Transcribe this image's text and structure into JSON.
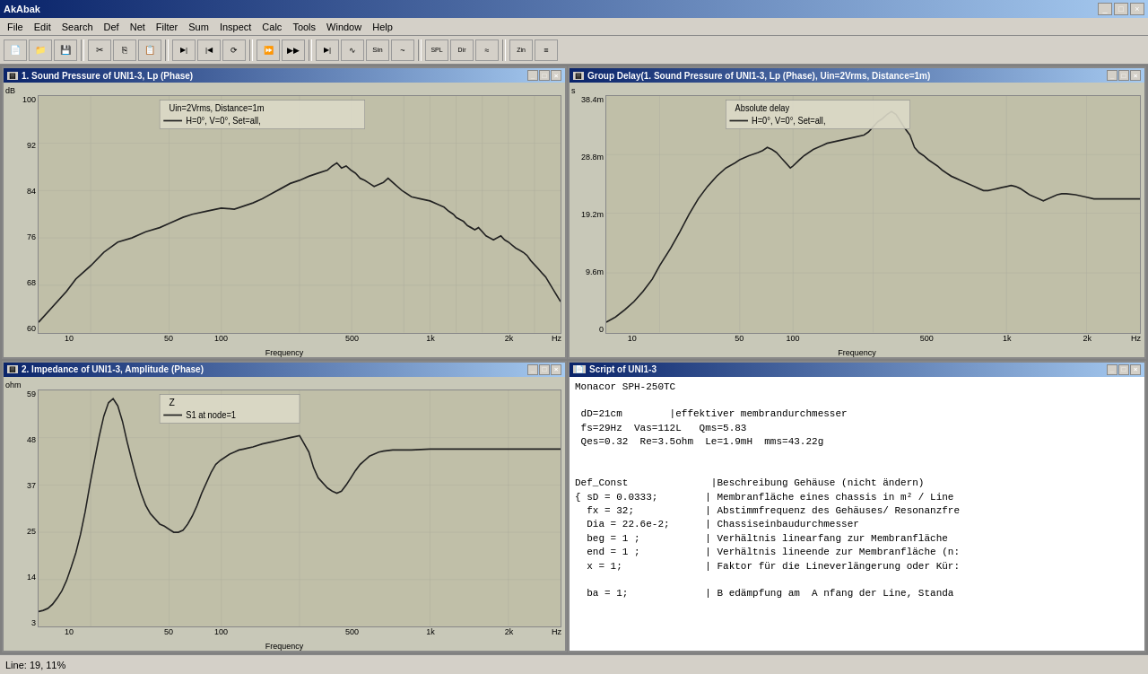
{
  "app": {
    "title": "AkAbak",
    "titlebar_buttons": [
      "-",
      "□",
      "×"
    ]
  },
  "menu": {
    "items": [
      "File",
      "Edit",
      "Search",
      "Def",
      "Net",
      "Filter",
      "Sum",
      "Inspect",
      "Calc",
      "Tools",
      "Window",
      "Help"
    ]
  },
  "toolbar": {
    "buttons": [
      "📁",
      "💾",
      "⎘",
      "✂",
      "📋",
      "↩",
      "↪",
      "🔍",
      "🖨",
      "■",
      "▶",
      "⏹",
      "≋",
      "∿",
      "Sin",
      "~",
      "SPL",
      "Dir",
      "≈",
      "Zin",
      "≡"
    ]
  },
  "chart1": {
    "title": "1. Sound Pressure of UNI1-3, Lp (Phase)",
    "y_unit": "dB",
    "y_labels": [
      "100",
      "92",
      "84",
      "76",
      "68",
      "60"
    ],
    "x_labels": [
      "10",
      "50",
      "100",
      "500",
      "1k",
      "2k"
    ],
    "x_title": "Frequency",
    "x_unit": "Hz",
    "legend_line1": "Uin=2Vrms, Distance=1m",
    "legend_line2": "H=0°, V=0°, Set=all,"
  },
  "chart2": {
    "title": "Group Delay(1. Sound Pressure of UNI1-3, Lp (Phase), Uin=2Vrms, Distance=1m)",
    "y_unit": "s",
    "y_labels": [
      "38.4m",
      "28.8m",
      "19.2m",
      "9.6m",
      "0"
    ],
    "x_labels": [
      "10",
      "50",
      "100",
      "500",
      "1k",
      "2k"
    ],
    "x_title": "Frequency",
    "x_unit": "Hz",
    "legend_line1": "Absolute delay",
    "legend_line2": "H=0°, V=0°, Set=all,"
  },
  "chart3": {
    "title": "2. Impedance of UNI1-3, Amplitude (Phase)",
    "y_unit": "ohm",
    "y_labels": [
      "59",
      "48",
      "37",
      "25",
      "14",
      "3"
    ],
    "x_labels": [
      "10",
      "50",
      "100",
      "500",
      "1k",
      "2k"
    ],
    "x_title": "Frequency",
    "x_unit": "Hz",
    "legend_line1": "Z",
    "legend_line2": "S1 at node=1"
  },
  "script": {
    "title": "Script of UNI1-3",
    "content": "Monacor SPH-250TC\n\n dD=21cm        |effektiver membrandurchmesser\n fs=29Hz  Vas=112L   Qms=5.83\n Qes=0.32  Re=3.5ohm  Le=1.9mH  mms=43.22g\n\n\nDef_Const              |Beschreibung Gehäuse (nicht ändern)\n{ sD = 0.0333;        | Membranfläche eines chassis in m² / Line\n  fx = 32;            | Abstimmfrequenz des Gehäuses/ Resonanzfre\n  Dia = 22.6e-2;      | Chassiseinbaudurchmesser\n  beg = 1 ;           | Verhältnis linearfang zur Membranfläche\n  end = 1 ;           | Verhältnis lineende zur Membranfläche (n:\n  x = 1;              | Faktor für die Lineverlängerung oder Kür:\n\n  ba = 1;             | B edämpfung am  A nfang der Line, Standa"
  },
  "status_bar": {
    "text": "Line: 19, 11%"
  }
}
